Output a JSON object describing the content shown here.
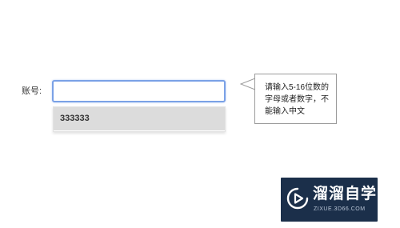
{
  "form": {
    "account_label": "账号:",
    "account_input_value": ""
  },
  "suggestions": {
    "items": [
      "333333"
    ]
  },
  "tooltip": {
    "lines": [
      "请输入5-16位数的",
      "字母或者数字，不",
      "能输入中文"
    ]
  },
  "watermark": {
    "name": "溜溜自学",
    "url": "ZIXUE.3D66.COM"
  },
  "colors": {
    "input_focus_border": "#7aa1e6",
    "suggestion_highlight": "#dcdcdc",
    "watermark_bg": "#1b2f4a"
  },
  "icons": {
    "tooltip_pointer": "left-pointing-callout-arrow",
    "watermark_logo": "play-circle-logo"
  }
}
